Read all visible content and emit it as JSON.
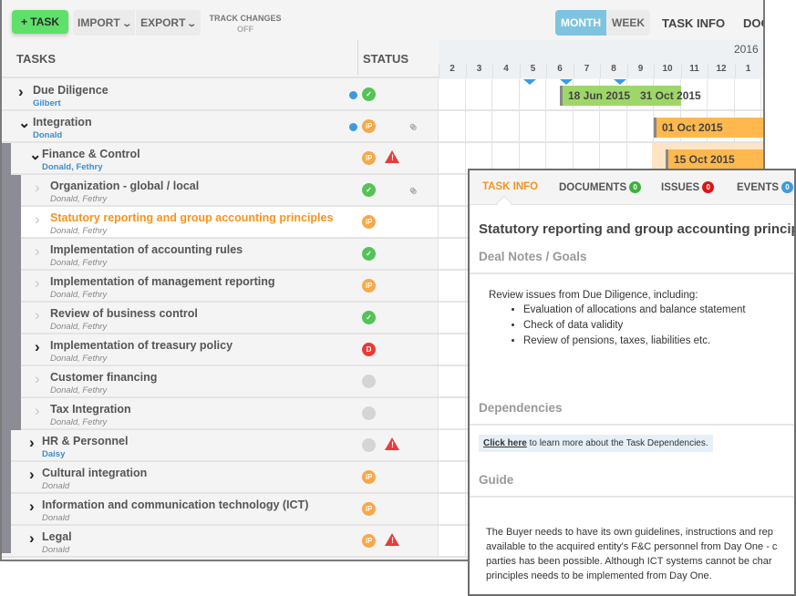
{
  "toolbar": {
    "add_task": "+ TASK",
    "import": "IMPORT",
    "export": "EXPORT",
    "track_changes_label": "TRACK CHANGES",
    "track_changes_value": "OFF",
    "view_month": "MONTH",
    "view_week": "WEEK",
    "active_view": "MONTH",
    "task_info": "TASK INFO",
    "docs": "DOC"
  },
  "table": {
    "col_tasks": "TASKS",
    "col_status": "STATUS"
  },
  "timeline": {
    "months": [
      "2",
      "3",
      "4",
      "5",
      "6",
      "7",
      "8",
      "9",
      "10",
      "11",
      "12",
      "1"
    ],
    "year_label": "2016"
  },
  "tasks": [
    {
      "name": "Due Diligence",
      "owner": "Gilbert",
      "status": "done",
      "status_text": "✓",
      "dot": true,
      "warn": false,
      "link": false,
      "expanded": false
    },
    {
      "name": "Integration",
      "owner": "Donald",
      "status": "in-progress",
      "status_text": "iP",
      "dot": true,
      "warn": false,
      "link": true,
      "expanded": true
    },
    {
      "name": "Finance & Control",
      "owner": "Donald, Fethry",
      "status": "in-progress",
      "status_text": "iP",
      "dot": false,
      "warn": true,
      "link": false,
      "expanded": true
    },
    {
      "name": "Organization - global / local",
      "owner": "Donald, Fethry",
      "status": "done",
      "status_text": "✓",
      "dot": false,
      "warn": false,
      "link": true
    },
    {
      "name": "Statutory reporting and group accounting principles",
      "owner": "Donald, Fethry",
      "status": "in-progress",
      "status_text": "iP",
      "dot": false,
      "warn": false,
      "link": false,
      "selected": true
    },
    {
      "name": "Implementation of accounting rules",
      "owner": "Donald, Fethry",
      "status": "done",
      "status_text": "✓"
    },
    {
      "name": "Implementation of management reporting",
      "owner": "Donald, Fethry",
      "status": "in-progress",
      "status_text": "iP"
    },
    {
      "name": "Review of business control",
      "owner": "Donald, Fethry",
      "status": "done",
      "status_text": "✓"
    },
    {
      "name": "Implementation of treasury policy",
      "owner": "Donald, Fethry",
      "status": "delayed",
      "status_text": "D"
    },
    {
      "name": "Customer financing",
      "owner": "Donald, Fethry",
      "status": "not-started",
      "status_text": ""
    },
    {
      "name": "Tax Integration",
      "owner": "Donald, Fethry",
      "status": "not-started",
      "status_text": ""
    },
    {
      "name": "HR & Personnel",
      "owner": "Daisy",
      "status": "not-started",
      "status_text": "",
      "warn": true
    },
    {
      "name": "Cultural integration",
      "owner": "Donald",
      "status": "in-progress",
      "status_text": "iP"
    },
    {
      "name": "Information and communication technology (ICT)",
      "owner": "Donald",
      "status": "in-progress",
      "status_text": "iP"
    },
    {
      "name": "Legal",
      "owner": "Donald",
      "status": "in-progress",
      "status_text": "iP",
      "warn": true
    }
  ],
  "gantt_bars": [
    {
      "task": "Due Diligence",
      "start_label": "18 Jun 2015",
      "end_label": "31 Oct 2015",
      "color": "#9fd66a"
    },
    {
      "task": "Integration",
      "start_label": "01 Oct 2015",
      "color": "#ffb84d"
    },
    {
      "task": "Finance & Control",
      "start_label": "15 Oct 2015",
      "color": "#ffb84d"
    }
  ],
  "panel": {
    "tabs": [
      {
        "label": "TASK INFO",
        "active": true
      },
      {
        "label": "DOCUMENTS",
        "count": "0"
      },
      {
        "label": "ISSUES",
        "count": "0"
      },
      {
        "label": "EVENTS",
        "count": "0"
      }
    ],
    "title": "Statutory reporting and group accounting principles",
    "section_notes": "Deal Notes / Goals",
    "notes_intro": "Review issues from Due Diligence, including:",
    "notes_items": [
      "Evaluation of allocations and balance statement",
      "Check of data validity",
      "Review of pensions, taxes, liabilities etc."
    ],
    "section_dependencies": "Dependencies",
    "dep_link": "Click here",
    "dep_text": " to learn more about the Task Dependencies.",
    "section_guide": "Guide",
    "guide_lines": [
      "The Buyer needs to have its own guidelines, instructions and rep",
      "available to the acquired entity's F&C personnel from Day One -  c",
      "parties has been possible. Although ICT systems cannot be char",
      "principles needs to be implemented from Day One."
    ]
  },
  "colors": {
    "accent_orange": "#f7931e",
    "done_green": "#55c357",
    "in_progress_orange": "#f7a84a",
    "delayed_red": "#ea3a35",
    "milestone_blue": "#3b9be0",
    "add_task_green": "#5ee06b"
  }
}
